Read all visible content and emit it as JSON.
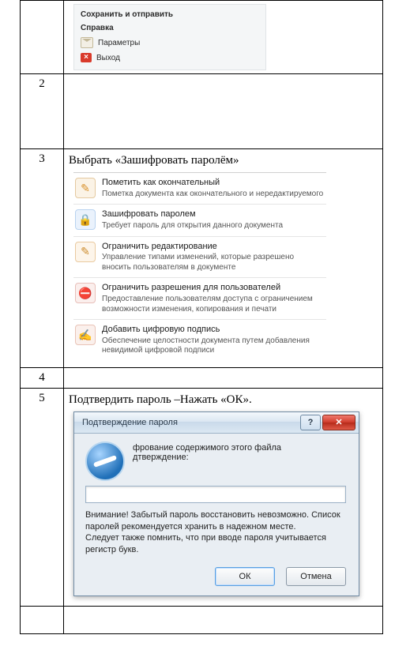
{
  "rows": {
    "r2_num": "2",
    "r3_num": "3",
    "r4_num": "4",
    "r5_num": "5"
  },
  "row1_menu": {
    "item_save_send": "Сохранить и отправить",
    "item_help": "Справка",
    "item_options_label": "Параметры",
    "item_exit_label": "Выход"
  },
  "row3": {
    "title": "Выбрать «Зашифровать паролём»",
    "items": [
      {
        "t1": "Пометить как окончательный",
        "t2": "Пометка документа как окончательного и нередактируемого"
      },
      {
        "t1": "Зашифровать паролем",
        "t2": "Требует пароль для открытия данного документа"
      },
      {
        "t1": "Ограничить редактирование",
        "t2": "Управление типами изменений, которые разрешено вносить пользователям в документе"
      },
      {
        "t1": "Ограничить разрешения для пользователей",
        "t2": "Предоставление пользователям доступа с ограничением возможности изменения, копирования и печати"
      },
      {
        "t1": "Добавить цифровую подпись",
        "t2": "Обеспечение целостности документа путем добавления невидимой цифровой подписи"
      }
    ]
  },
  "row5": {
    "title": "Подтвердить пароль –Нажать «ОК».",
    "dialog": {
      "caption": "Подтверждение пароля",
      "line1": "фрование содержимого этого файла",
      "line2": "дтверждение:",
      "warning1": "Внимание! Забытый пароль восстановить невозможно. Список паролей рекомендуется хранить в надежном месте.",
      "warning2": "Следует также помнить, что при вводе пароля учитывается регистр букв.",
      "ok": "ОК",
      "cancel": "Отмена"
    }
  }
}
